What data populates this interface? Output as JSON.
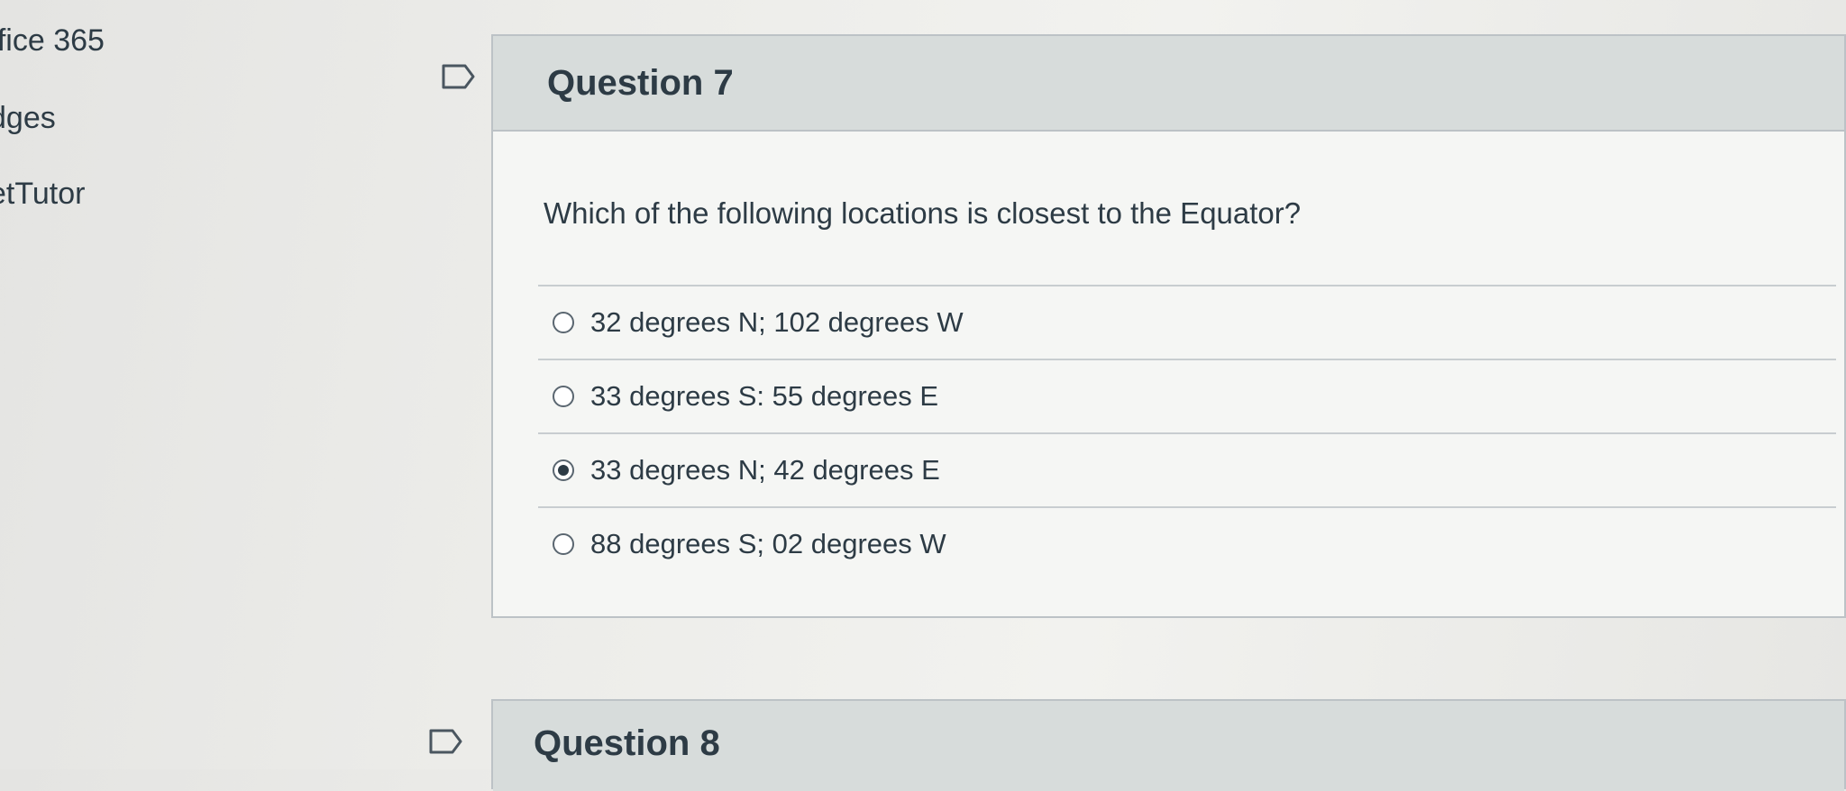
{
  "sidebar": {
    "items": [
      {
        "label": "ffice 365"
      },
      {
        "label": "dges"
      },
      {
        "label": "etTutor"
      }
    ]
  },
  "questions": [
    {
      "title": "Question 7",
      "text": "Which of the following locations is closest to the Equator?",
      "answers": [
        {
          "label": "32 degrees N; 102 degrees W",
          "selected": false
        },
        {
          "label": "33 degrees S: 55 degrees E",
          "selected": false
        },
        {
          "label": "33 degrees N; 42 degrees E",
          "selected": true
        },
        {
          "label": "88 degrees S; 02 degrees W",
          "selected": false
        }
      ]
    },
    {
      "title": "Question 8"
    }
  ],
  "icons": {
    "flag": "flag-outline-icon"
  },
  "colors": {
    "text": "#2d3b45",
    "header_bg": "#d7dcdb",
    "border": "#bcc2c6"
  }
}
